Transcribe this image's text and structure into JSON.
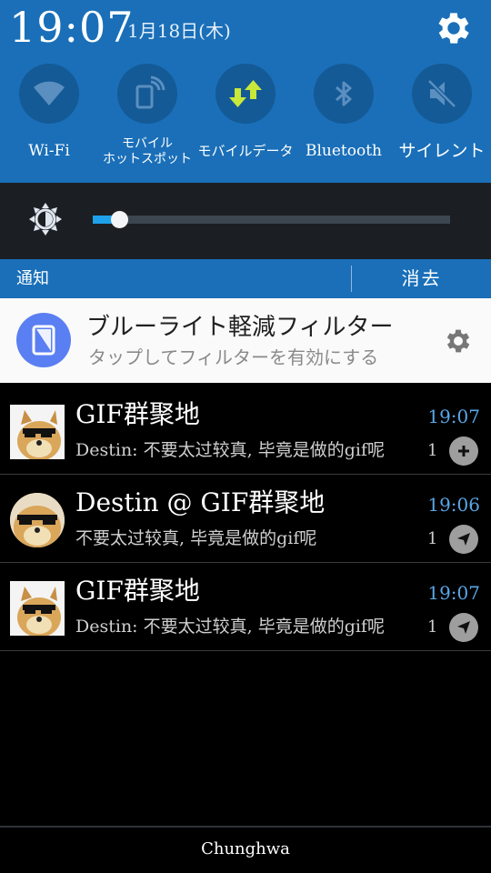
{
  "status": {
    "time": "19:07",
    "date": "1月18日(木)"
  },
  "quick_settings": [
    {
      "label": "Wi-Fi",
      "icon": "wifi-icon"
    },
    {
      "label": "モバイル\nホットスポット",
      "icon": "hotspot-icon"
    },
    {
      "label": "モバイルデータ",
      "icon": "mobile-data-icon"
    },
    {
      "label": "Bluetooth",
      "icon": "bluetooth-icon"
    },
    {
      "label": "サイレント",
      "icon": "silent-icon"
    }
  ],
  "brightness": {
    "level": 0.07,
    "icon": "brightness-icon"
  },
  "notifications_header": {
    "label": "通知",
    "clear_label": "消去"
  },
  "filter_card": {
    "title": "ブルーライト軽減フィルター",
    "subtitle": "タップしてフィルターを有効にする"
  },
  "messages": [
    {
      "title": "GIF群聚地",
      "text": "Destin: 不要太过较真, 毕竟是做的gif呢",
      "time": "19:07",
      "count": "1",
      "action": "add-icon"
    },
    {
      "title": "Destin @ GIF群聚地",
      "text": "不要太过较真, 毕竟是做的gif呢",
      "time": "19:06",
      "count": "1",
      "action": "send-icon"
    },
    {
      "title": "GIF群聚地",
      "text": "Destin: 不要太过较真, 毕竟是做的gif呢",
      "time": "19:07",
      "count": "1",
      "action": "send-icon"
    }
  ],
  "carrier": "Chunghwa",
  "colors": {
    "accent": "#1a6fb8",
    "tile": "#145a96",
    "filter_icon": "#5a7ff2",
    "time_blue": "#5aa6e6",
    "data_green": "#c8e83a"
  }
}
